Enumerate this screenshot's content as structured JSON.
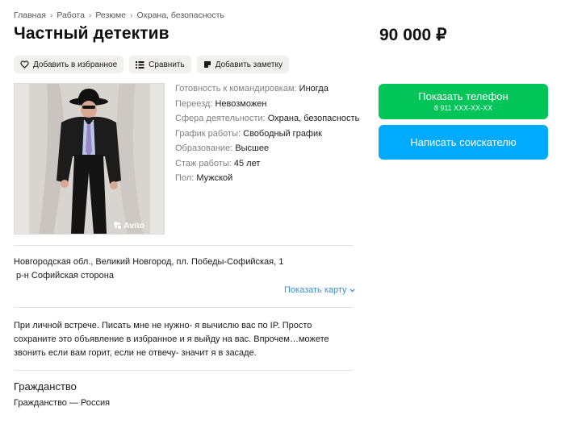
{
  "breadcrumb": {
    "items": [
      "Главная",
      "Работа",
      "Резюме",
      "Охрана, безопасность"
    ],
    "separator": "›"
  },
  "listing": {
    "title": "Частный детектив",
    "price": "90 000 ₽"
  },
  "actions": {
    "favorite": "Добавить в избранное",
    "compare": "Сравнить",
    "note": "Добавить заметку"
  },
  "photo": {
    "watermark": "Avito"
  },
  "params": [
    {
      "key": "Готовность к командировкам:",
      "value": "Иногда"
    },
    {
      "key": "Переезд:",
      "value": "Невозможен"
    },
    {
      "key": "Сфера деятельности:",
      "value": "Охрана, безопасность"
    },
    {
      "key": "График работы:",
      "value": "Свободный график"
    },
    {
      "key": "Образование:",
      "value": "Высшее"
    },
    {
      "key": "Стаж работы:",
      "value": "45 лет"
    },
    {
      "key": "Пол:",
      "value": "Мужской"
    }
  ],
  "contact": {
    "show_phone": "Показать телефон",
    "phone_masked": "8 911 XXX-XX-XX",
    "write": "Написать соискателю"
  },
  "address": {
    "line": "Новгородская обл., Великий Новгород, пл. Победы-Софийская, 1",
    "district": "р-н Софийская сторона",
    "show_map": "Показать карту"
  },
  "description": {
    "text": "При личной встрече. Писать мне не нужно- я вычислю вас по IP. Просто сохраните это объявление в избранное и я выйду на вас. Впрочем…можете звонить если вам горит, если не отвечу- значит я в засаде."
  },
  "citizenship": {
    "heading": "Гражданство",
    "value": "Гражданство — Россия"
  },
  "colors": {
    "green": "#02c55a",
    "blue": "#00aaff",
    "link": "#3a8fd0"
  }
}
